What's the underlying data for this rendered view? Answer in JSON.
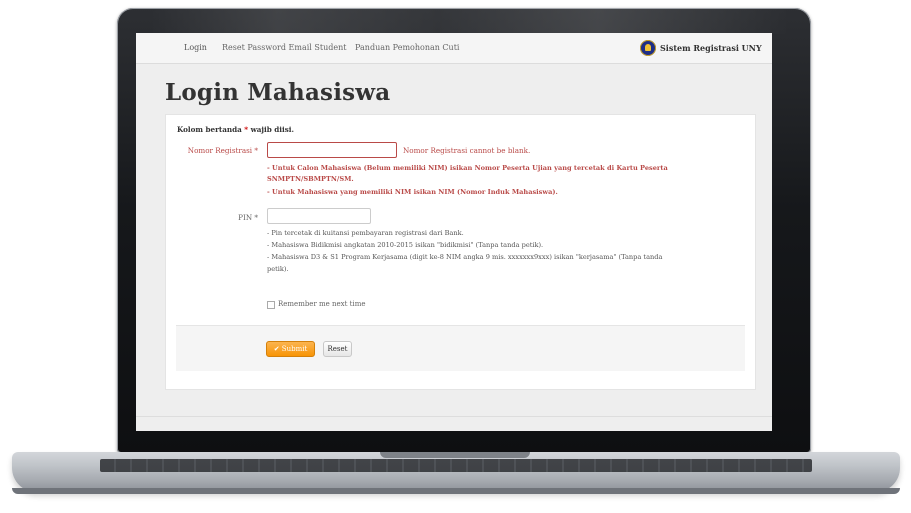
{
  "navbar": {
    "items": [
      "Login",
      "Reset Password Email Student",
      "Panduan Pemohonan Cuti"
    ],
    "brand": "Sistem Registrasi UNY"
  },
  "page": {
    "title": "Login Mahasiswa",
    "required_note_prefix": "Kolom bertanda ",
    "required_star": "*",
    "required_note_suffix": " wajib diisi."
  },
  "form": {
    "nomor_label": "Nomor Registrasi *",
    "nomor_value": "",
    "nomor_error": "Nomor Registrasi cannot be blank.",
    "nomor_hints": [
      "- Untuk Calon Mahasiswa (Belum memiliki NIM) isikan Nomor Peserta Ujian yang tercetak di Kartu Peserta",
      "SNMPTN/SBMPTN/SM.",
      "- Untuk Mahasiswa yang memiliki NIM isikan NIM (Nomor Induk Mahasiswa)."
    ],
    "pin_label": "PIN *",
    "pin_value": "",
    "pin_hints": [
      "- Pin tercetak di kuitansi pembayaran registrasi dari Bank.",
      "- Mahasiswa Bidikmisi angkatan 2010-2015 isikan \"bidikmisi\" (Tanpa tanda petik).",
      "- Mahasiswa D3 & S1 Program Kerjasama (digit ke-8 NIM angka 9 mis. xxxxxxx9xxx) isikan \"kerjasama\" (Tanpa tanda",
      "petik)."
    ],
    "remember_label": "Remember me next time",
    "remember_checked": false,
    "submit_label": "✔ Submit",
    "reset_label": "Reset"
  },
  "colors": {
    "error": "#b94a48",
    "submit": "#f89406",
    "brand_logo": "#1f2f86"
  }
}
